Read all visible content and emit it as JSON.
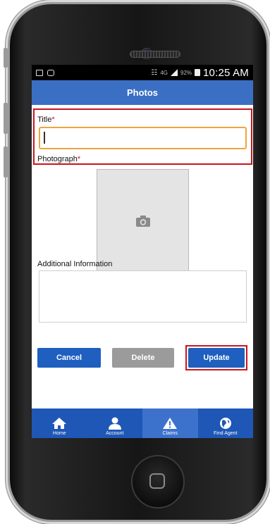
{
  "status_bar": {
    "network_label": "4G",
    "battery_percent": "92%",
    "time": "10:25 AM"
  },
  "app_bar": {
    "title": "Photos"
  },
  "form": {
    "title_label": "Title",
    "photograph_label": "Photograph",
    "required_marker": "*",
    "title_value": "",
    "additional_info_label": "Additional Information",
    "additional_info_value": ""
  },
  "buttons": {
    "cancel": "Cancel",
    "delete": "Delete",
    "update": "Update"
  },
  "bottom_nav": {
    "items": [
      {
        "label": "Home",
        "icon": "home-icon"
      },
      {
        "label": "Account",
        "icon": "account-icon"
      },
      {
        "label": "Claims",
        "icon": "warning-icon"
      },
      {
        "label": "Find Agent",
        "icon": "globe-icon"
      }
    ],
    "active": "Claims"
  },
  "colors": {
    "app_bar": "#3a6fc4",
    "primary_button": "#1f5fbf",
    "disabled_button": "#9b9b9b",
    "highlight": "#c8151b",
    "input_focus": "#f0a53a",
    "bottom_nav": "#1e57b5"
  }
}
